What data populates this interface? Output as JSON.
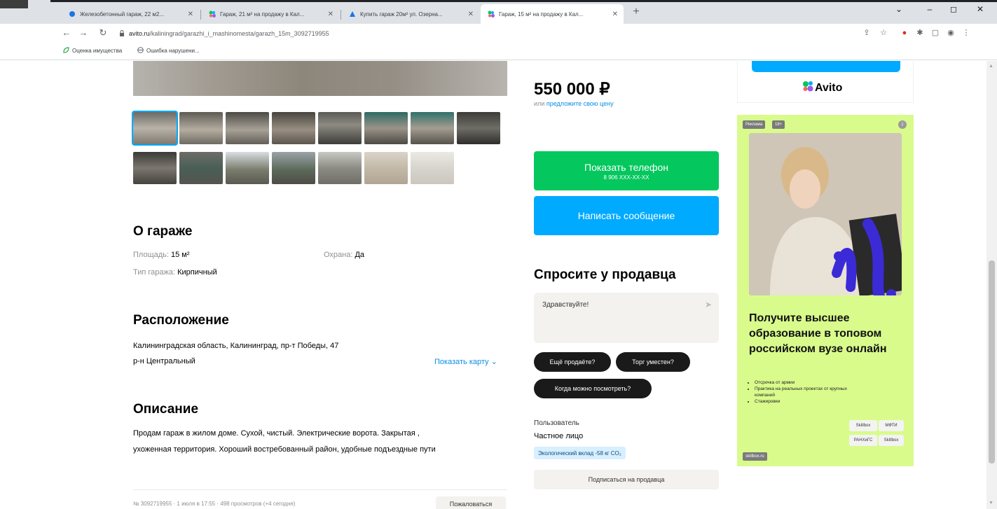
{
  "browser": {
    "tabs": [
      {
        "title": "Железобетонный гараж, 22 м2..."
      },
      {
        "title": "Гараж, 21 м² на продажу в Кал..."
      },
      {
        "title": "Купить гараж 20м² ул. Озерна..."
      },
      {
        "title": "Гараж, 15 м² на продажу в Кал..."
      }
    ],
    "url_host": "avito.ru",
    "url_path": "/kaliningrad/garazhi_i_mashinomesta/garazh_15m_3092719955",
    "bookmarks": [
      "Оценка имущества",
      "Ошибка нарушени..."
    ]
  },
  "listing": {
    "price": "550 000 ₽",
    "price_note_prefix": "или",
    "price_note_link": "предложите свою цену",
    "show_phone": "Показать телефон",
    "phone_mask": "8 906 XXX-XX-XX",
    "write_message": "Написать сообщение",
    "about_title": "О гараже",
    "area_label": "Площадь:",
    "area_value": "15 м²",
    "guard_label": "Охрана:",
    "guard_value": "Да",
    "type_label": "Тип гаража:",
    "type_value": "Кирпичный",
    "location_title": "Расположение",
    "address": "Калининградская область, Калининград, пр-т Победы, 47",
    "district": "р-н Центральный",
    "show_map": "Показать карту",
    "description_title": "Описание",
    "description_line1": "Продам гараж в жилом доме. Сухой, чистый. Электрические ворота. Закрытая ,",
    "description_line2": "ухоженная территория. Хороший востребованный район, удобные подъездные пути",
    "footer_meta": "№ 3092719955 · 1 июля в 17:55 · 498 просмотров (+4 сегодня)",
    "report_button": "Пожаловаться"
  },
  "seller": {
    "ask_title": "Спросите у продавца",
    "ask_text": "Здравствуйте!",
    "chips": [
      "Ещё продаёте?",
      "Торг уместен?",
      "Когда можно посмотреть?"
    ],
    "user_label": "Пользователь",
    "user_type": "Частное лицо",
    "eco": "Экологический вклад -58 кг CO₂",
    "subscribe": "Подписаться на продавца"
  },
  "avito_card": {
    "logo_text": "Avito"
  },
  "ad": {
    "badge_ad": "Реклама",
    "badge_age": "18+",
    "title": "Получите высшее образование в топовом российском вузе онлайн",
    "bullets": [
      "Отсрочка от армии",
      "Практика на реальных проектах от крупных компаний",
      "Стажировки"
    ],
    "logos": [
      "Skillbox",
      "МФТИ",
      "РАНХиГС",
      "Skillbox"
    ],
    "footer": "skillbox.ru"
  },
  "colors": {
    "green": "#04c75d",
    "blue": "#00aaff",
    "ad_bg": "#d9fb8c",
    "chip_bg": "#1a1a1a"
  }
}
